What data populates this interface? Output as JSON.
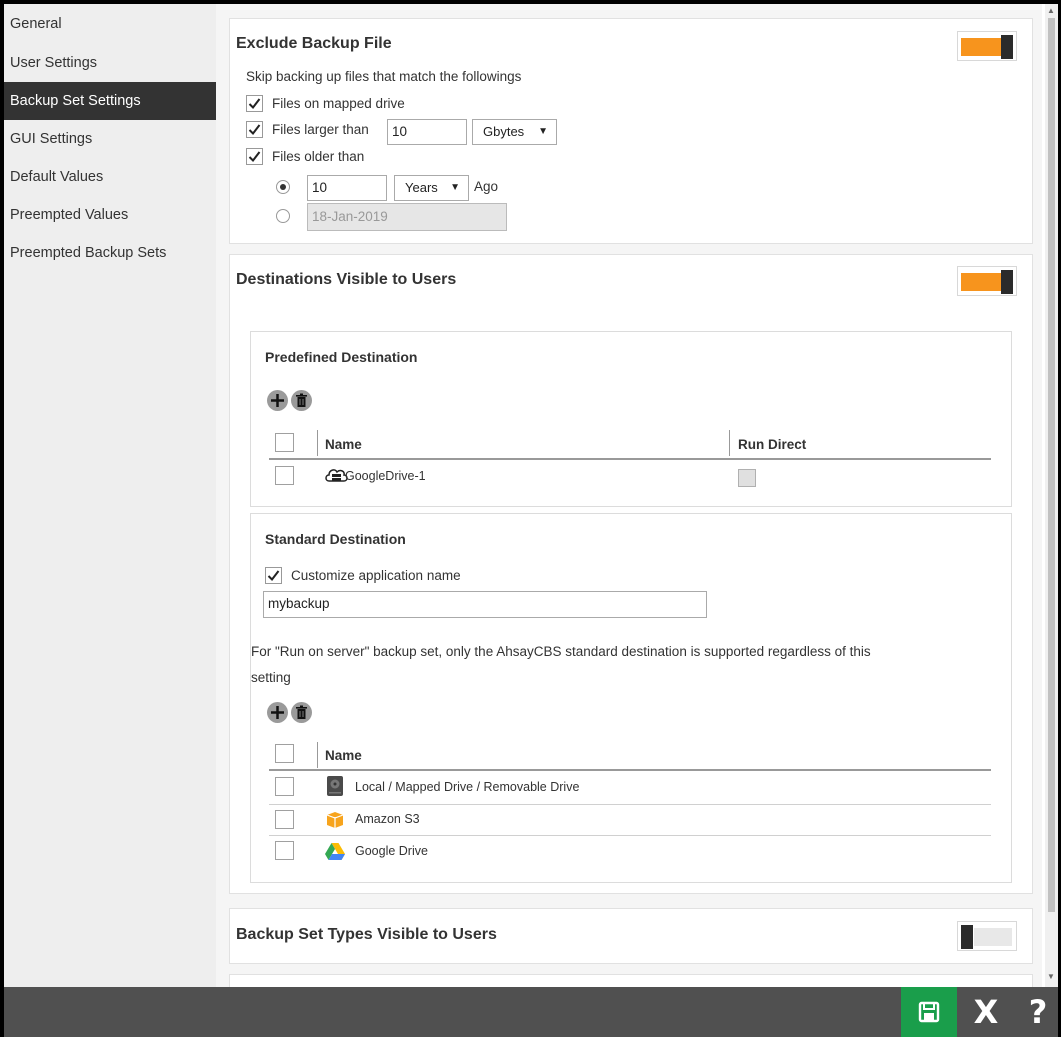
{
  "sidebar": {
    "items": [
      {
        "label": "General",
        "active": false
      },
      {
        "label": "User Settings",
        "active": false
      },
      {
        "label": "Backup Set Settings",
        "active": true
      },
      {
        "label": "GUI Settings",
        "active": false
      },
      {
        "label": "Default Values",
        "active": false
      },
      {
        "label": "Preempted Values",
        "active": false
      },
      {
        "label": "Preempted Backup Sets",
        "active": false
      }
    ]
  },
  "exclude": {
    "title": "Exclude Backup File",
    "enabled": true,
    "description": "Skip backing up files that match the followings",
    "mapped_drive_label": "Files on mapped drive",
    "larger_than_label": "Files larger than",
    "larger_than_value": "10",
    "size_unit": "Gbytes",
    "older_than_label": "Files older than",
    "age_value": "10",
    "age_unit": "Years",
    "ago_label": "Ago",
    "date_value": "18-Jan-2019"
  },
  "destinations": {
    "title": "Destinations Visible to Users",
    "enabled": true,
    "predefined": {
      "title": "Predefined Destination",
      "col_name": "Name",
      "col_run_direct": "Run Direct",
      "rows": [
        {
          "name": "GoogleDrive-1",
          "icon": "cloud-server-icon"
        }
      ]
    },
    "standard": {
      "title": "Standard Destination",
      "customize_label": "Customize application name",
      "app_name": "mybackup",
      "note": "For \"Run on server\" backup set, only the AhsayCBS standard destination is supported regardless of this",
      "note_cont": "setting",
      "col_name": "Name",
      "rows": [
        {
          "name": "Local / Mapped Drive / Removable Drive",
          "icon": "hard-drive-icon"
        },
        {
          "name": "Amazon S3",
          "icon": "amazon-s3-icon"
        },
        {
          "name": "Google Drive",
          "icon": "google-drive-icon"
        }
      ]
    }
  },
  "backup_types": {
    "title": "Backup Set Types Visible to Users",
    "enabled": false
  },
  "toolbar": {
    "save_icon": "floppy-disk-icon",
    "close_label": "X",
    "help_label": "?"
  }
}
